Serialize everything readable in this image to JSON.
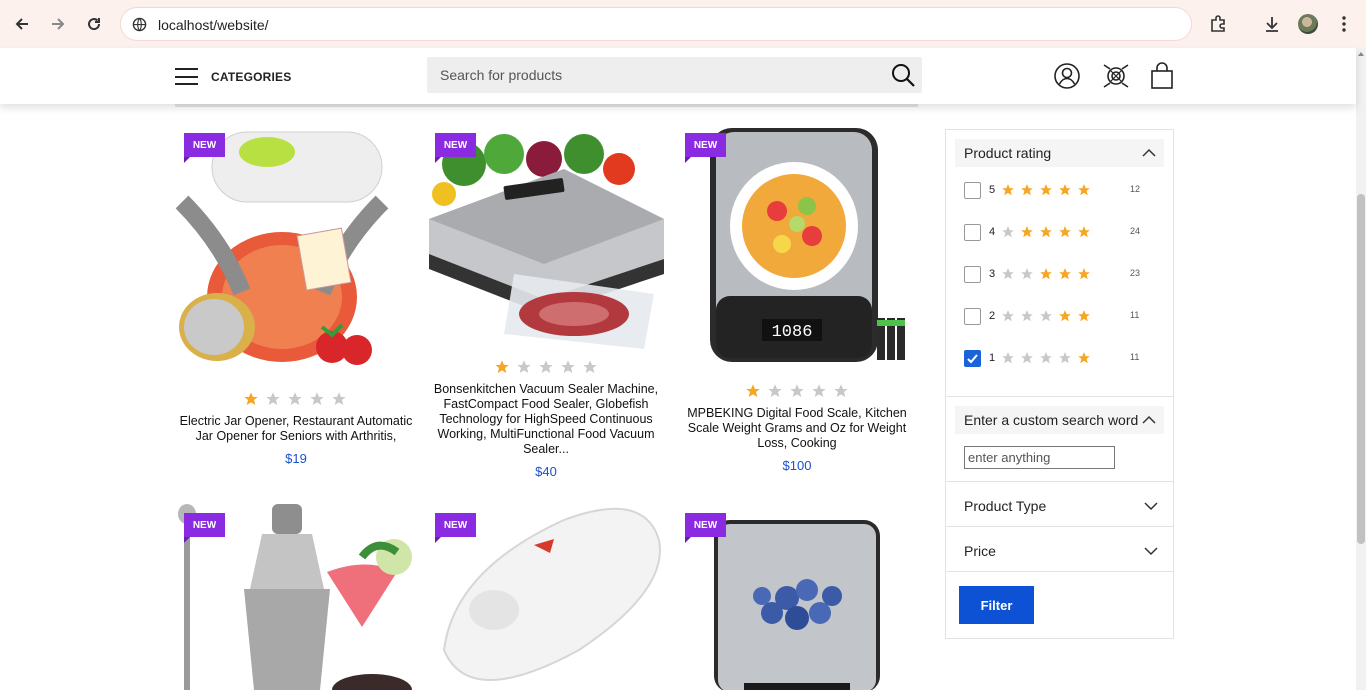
{
  "browser": {
    "url": "localhost/website/"
  },
  "header": {
    "categories_label": "CATEGORIES",
    "search_placeholder": "Search for products"
  },
  "products": [
    {
      "badge": "NEW",
      "title": "Electric Jar Opener, Restaurant Automatic Jar Opener for Seniors with Arthritis,",
      "price": "$19",
      "rating": 1
    },
    {
      "badge": "NEW",
      "title": "Bonsenkitchen Vacuum Sealer Machine, FastCompact Food Sealer, Globefish Technology for HighSpeed Continuous Working, MultiFunctional Food Vacuum Sealer...",
      "price": "$40",
      "rating": 1
    },
    {
      "badge": "NEW",
      "title": "MPBEKING Digital Food Scale, Kitchen Scale Weight Grams and Oz for Weight Loss, Cooking",
      "price": "$100",
      "rating": 1
    },
    {
      "badge": "NEW"
    },
    {
      "badge": "NEW"
    },
    {
      "badge": "NEW"
    }
  ],
  "filters": {
    "rating_title": "Product rating",
    "ratings": [
      {
        "label": "5",
        "count": "12",
        "checked": false
      },
      {
        "label": "4",
        "count": "24",
        "checked": false
      },
      {
        "label": "3",
        "count": "23",
        "checked": false
      },
      {
        "label": "2",
        "count": "11",
        "checked": false
      },
      {
        "label": "1",
        "count": "11",
        "checked": true
      }
    ],
    "custom_title": "Enter a custom search word",
    "custom_placeholder": "enter anything",
    "product_type_title": "Product Type",
    "price_title": "Price",
    "filter_button": "Filter"
  },
  "colors": {
    "accent_blue": "#0d52d4",
    "badge_purple": "#8a2be2",
    "star_gold": "#f5a623",
    "star_grey": "#c8c8c8",
    "price_blue": "#1a52c9"
  }
}
